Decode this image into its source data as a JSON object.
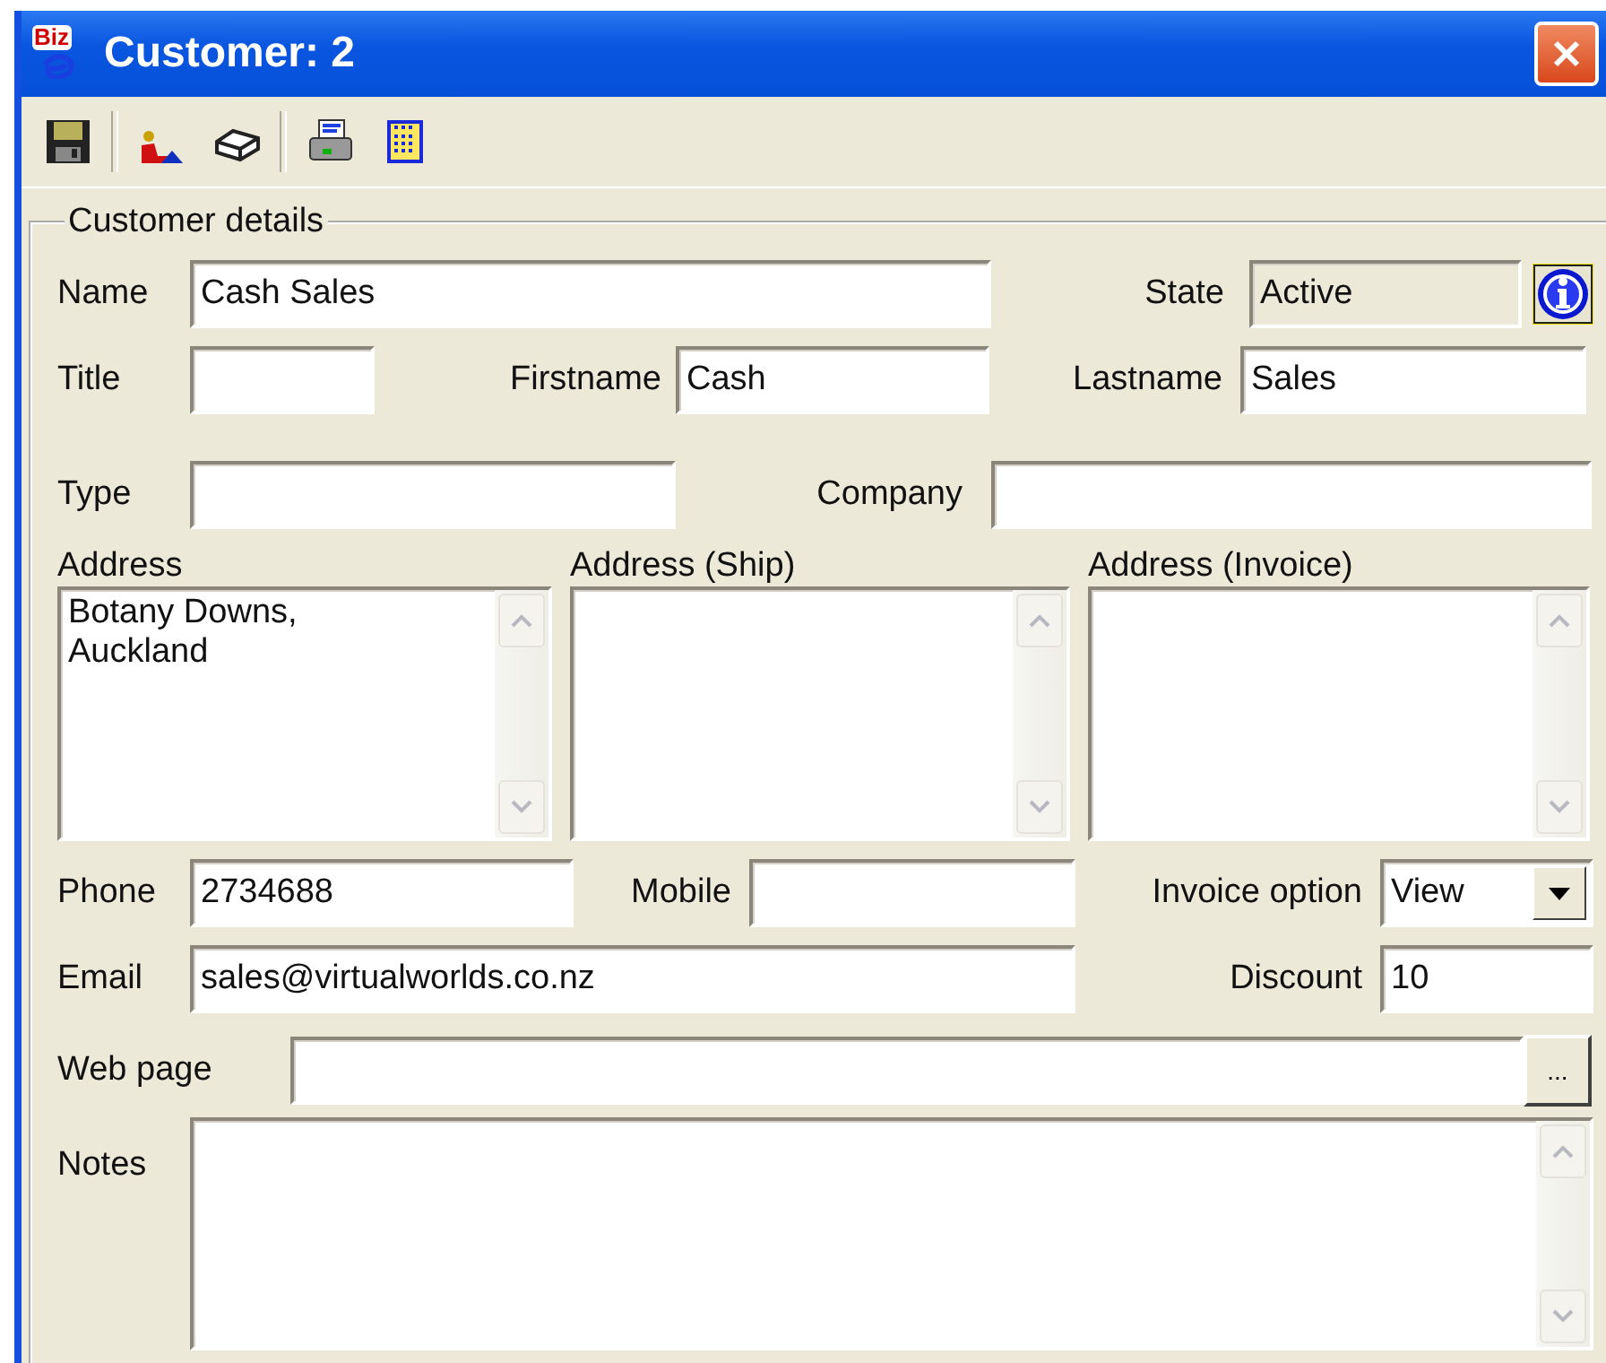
{
  "window": {
    "logo": "Biz",
    "title": "Customer: 2"
  },
  "group": {
    "title": "Customer details"
  },
  "name": {
    "label": "Name",
    "value": "Cash Sales"
  },
  "state": {
    "label": "State",
    "value": "Active",
    "disabled": true
  },
  "title": {
    "label": "Title"
  },
  "firstname": {
    "label": "Firstname",
    "value": "Cash"
  },
  "lastname": {
    "label": "Lastname",
    "value": "Sales"
  },
  "type": {
    "label": "Type"
  },
  "company": {
    "label": "Company"
  },
  "addresses": [
    {
      "label": "Address",
      "value": "Botany Downs,\nAuckland"
    },
    {
      "label": "Address (Ship)"
    },
    {
      "label": "Address (Invoice)"
    }
  ],
  "phone": {
    "label": "Phone",
    "value": "2734688"
  },
  "mobile": {
    "label": "Mobile"
  },
  "invoice_option": {
    "label": "Invoice option",
    "value": "View"
  },
  "email": {
    "label": "Email",
    "value": "sales@virtualworlds.co.nz"
  },
  "discount": {
    "label": "Discount",
    "value": "10"
  },
  "web_page": {
    "label": "Web page",
    "button": "..."
  },
  "notes": {
    "label": "Notes"
  }
}
